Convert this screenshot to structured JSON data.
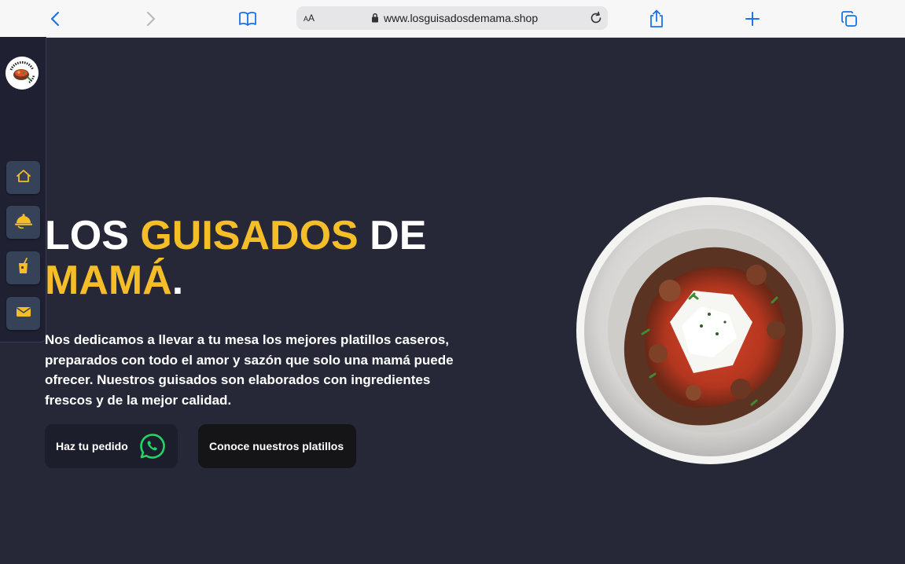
{
  "browser": {
    "url": "www.losguisadosdemama.shop",
    "text_size_label_small": "A",
    "text_size_label_large": "A",
    "icons": [
      "back-icon",
      "forward-icon",
      "bookmarks-icon",
      "lock-icon",
      "reload-icon",
      "share-icon",
      "new-tab-icon",
      "tabs-icon"
    ]
  },
  "sidebar": {
    "logo_text": "LOS GUISADOS DE MAMA",
    "items": [
      {
        "icon": "home-icon"
      },
      {
        "icon": "food-cloche-icon"
      },
      {
        "icon": "drink-icon"
      },
      {
        "icon": "mail-icon"
      }
    ],
    "accent": "#f5bd28"
  },
  "hero": {
    "title_part1": "LOS ",
    "title_highlight1": "GUISADOS",
    "title_part2": " DE",
    "title_highlight2": "MAMÁ",
    "title_dot": ".",
    "description": "Nos dedicamos a llevar a tu mesa los mejores platillos caseros, preparados con todo el amor y sazón que solo una mamá puede ofrecer. Nuestros guisados son elaborados con ingredientes frescos y de la mejor calidad.",
    "order_button": "Haz tu pedido",
    "order_button_icon": "whatsapp-icon",
    "dishes_button": "Conoce nuestros platillos"
  },
  "colors": {
    "background": "#262838",
    "accent_yellow": "#f5bd28",
    "whatsapp_green": "#25d366"
  }
}
